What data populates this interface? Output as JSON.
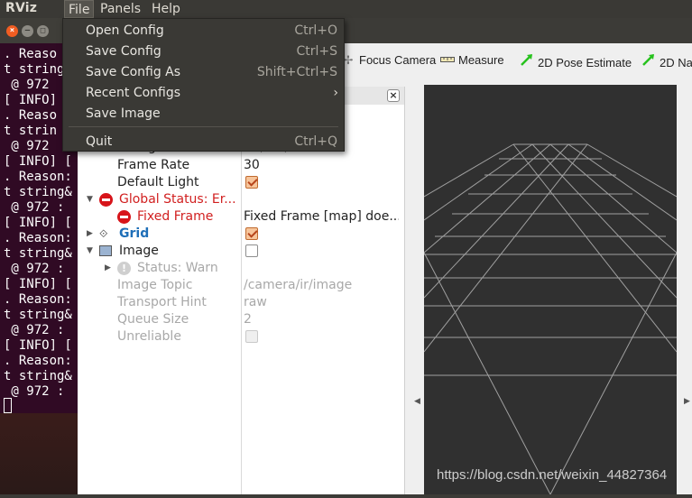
{
  "menubar": {
    "app_name": "RViz",
    "items": [
      {
        "label": "File"
      },
      {
        "label": "Panels"
      },
      {
        "label": "Help"
      }
    ]
  },
  "file_menu": {
    "items": [
      {
        "label": "Open Config",
        "shortcut": "Ctrl+O"
      },
      {
        "label": "Save Config",
        "shortcut": "Ctrl+S"
      },
      {
        "label": "Save Config As",
        "shortcut": "Shift+Ctrl+S"
      },
      {
        "label": "Recent Configs",
        "submenu_arrow": "›"
      },
      {
        "label": "Save Image"
      },
      {
        "label": "Quit",
        "shortcut": "Ctrl+Q"
      }
    ]
  },
  "terminal": {
    "lines": [
      ". Reaso",
      "t string",
      " @ 972",
      "[ INFO]",
      ". Reaso",
      "t strin",
      " @ 972",
      "[ INFO] [",
      ". Reason:",
      "t string&",
      " @ 972 :",
      "[ INFO] [",
      ". Reason:",
      "t string&",
      " @ 972 :",
      "[ INFO] [",
      ". Reason:",
      "t string&",
      " @ 972 :",
      "[ INFO] [",
      ". Reason:",
      "t string&",
      " @ 972 :"
    ]
  },
  "toolbar": {
    "items": [
      {
        "label": "Focus Camera",
        "icon": "focus-camera-icon"
      },
      {
        "label": "Measure",
        "icon": "ruler-icon"
      },
      {
        "label": "2D Pose Estimate",
        "icon": "green-arrow-icon"
      },
      {
        "label": "2D Na",
        "icon": "green-arrow-icon"
      }
    ]
  },
  "displays": {
    "partial_row": {
      "name": "Background Color",
      "value": "48; 48; 48"
    },
    "rows": [
      {
        "name": "Frame Rate",
        "value": "30"
      },
      {
        "name": "Default Light",
        "checked": true
      },
      {
        "name": "Global Status: Er...",
        "status": "error"
      },
      {
        "name": "Fixed Frame",
        "value": "Fixed Frame [map] doe...",
        "status": "error"
      },
      {
        "name": "Grid",
        "checked": true
      },
      {
        "name": "Image",
        "checked": false
      },
      {
        "name": "Status: Warn",
        "status": "warn"
      },
      {
        "name": "Image Topic",
        "value": "/camera/ir/image"
      },
      {
        "name": "Transport Hint",
        "value": "raw"
      },
      {
        "name": "Queue Size",
        "value": "2"
      },
      {
        "name": "Unreliable",
        "checked": false
      }
    ]
  },
  "colors": {
    "terminal_bg": "#300a24",
    "viewport_bg": "#303030",
    "error_red": "#d11f1f",
    "grid_blue": "#1f6fb8",
    "menu_bg": "#3a3935"
  },
  "watermark": "https://blog.csdn.net/weixin_44827364"
}
